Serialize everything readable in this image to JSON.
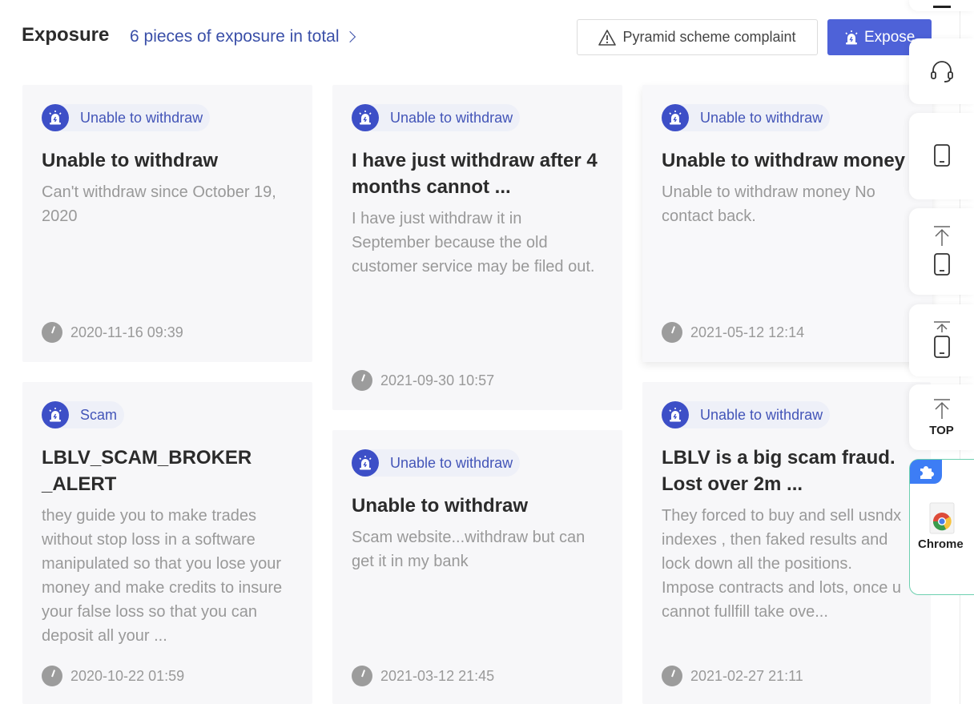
{
  "header": {
    "title": "Exposure",
    "total_link": "6 pieces of exposure in total",
    "complaint_button": "Pyramid scheme complaint",
    "expose_button": "Expose"
  },
  "cards": [
    {
      "tag": "Unable to withdraw",
      "title": "Unable to withdraw",
      "body": "Can't withdraw since October 19, 2020",
      "time": "2020-11-16 09:39"
    },
    {
      "tag": "Unable to withdraw",
      "title": "I have just withdraw after 4 months cannot ...",
      "body": "I have just withdraw it in September because the old customer service may be filed out.",
      "time": "2021-09-30 10:57"
    },
    {
      "tag": "Unable to withdraw",
      "title": "Unable to withdraw money",
      "body": "Unable to withdraw money No contact back.",
      "time": "2021-05-12 12:14"
    },
    {
      "tag": "Scam",
      "title": "LBLV_SCAM_BROKER _ALERT",
      "body": "they guide you to make trades without stop loss in a software manipulated so that you lose your money and make credits to insure your false loss so that you can deposit all your ...",
      "time": "2020-10-22 01:59"
    },
    {
      "tag": "Unable to withdraw",
      "title": "Unable to withdraw",
      "body": "Scam website...withdraw but can get it in my bank",
      "time": "2021-03-12 21:45"
    },
    {
      "tag": "Unable to withdraw",
      "title": "LBLV is a big scam fraud. Lost over 2m ...",
      "body": "They forced to buy and sell usndx indexes , then faked results and lock down all the positions.\nImpose contracts and lots, once u cannot fullfill take ove...",
      "time": "2021-02-27 21:11"
    }
  ],
  "sidebar": {
    "top_label": "TOP",
    "chrome_label": "Chrome"
  },
  "colors": {
    "accent": "#4e62d8",
    "tag_text": "#4355b8",
    "tag_icon_bg": "#3d4fc7",
    "card_bg": "#f7f7f9"
  }
}
